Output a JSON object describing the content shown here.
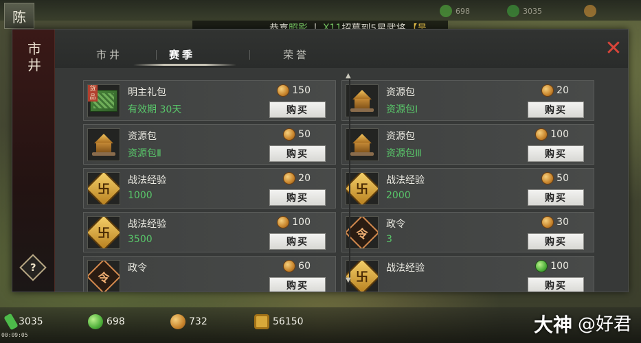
{
  "player": {
    "badge": "陈"
  },
  "top_bar_resources": [
    {
      "value": "698"
    },
    {
      "value": "3035"
    }
  ],
  "marquee": {
    "prefix": "恭喜",
    "name": "照影",
    "sep": "丨",
    "count": "X11",
    "text": "招募到5星武将",
    "tail": "【吴"
  },
  "panel": {
    "side_title": "市井",
    "help_label": "?",
    "close_label": "✕",
    "tabs": [
      {
        "label": "市井",
        "active": false
      },
      {
        "label": "赛季",
        "active": true
      },
      {
        "label": "荣誉",
        "active": false
      }
    ]
  },
  "shop": {
    "buy_label": "购买",
    "items": [
      {
        "name": "明主礼包",
        "sub": "有效期 30天",
        "price": "150",
        "currency": "gold",
        "icon": "gift-pack-icon",
        "tag": "货品"
      },
      {
        "name": "资源包",
        "sub": "资源包Ⅰ",
        "price": "20",
        "currency": "gold",
        "icon": "resource-pack-icon"
      },
      {
        "name": "资源包",
        "sub": "资源包Ⅱ",
        "price": "50",
        "currency": "gold",
        "icon": "resource-pack-icon"
      },
      {
        "name": "资源包",
        "sub": "资源包Ⅲ",
        "price": "100",
        "currency": "gold",
        "icon": "resource-pack-icon"
      },
      {
        "name": "战法经验",
        "sub": "1000",
        "price": "20",
        "currency": "gold",
        "icon": "skill-exp-icon",
        "glyph": "卐"
      },
      {
        "name": "战法经验",
        "sub": "2000",
        "price": "50",
        "currency": "gold",
        "icon": "skill-exp-icon",
        "glyph": "卐"
      },
      {
        "name": "战法经验",
        "sub": "3500",
        "price": "100",
        "currency": "gold",
        "icon": "skill-exp-icon",
        "glyph": "卐"
      },
      {
        "name": "政令",
        "sub": "3",
        "price": "30",
        "currency": "gold",
        "icon": "decree-icon",
        "glyph": "令"
      },
      {
        "name": "政令",
        "sub": "",
        "price": "60",
        "currency": "gold",
        "icon": "decree-icon",
        "glyph": "令"
      },
      {
        "name": "战法经验",
        "sub": "",
        "price": "100",
        "currency": "jade",
        "icon": "skill-exp-icon",
        "glyph": "卐"
      }
    ]
  },
  "bottom_resources": [
    {
      "value": "3035",
      "icon": "bamboo-icon",
      "color": "#4dbb4a"
    },
    {
      "value": "698",
      "icon": "jade-icon",
      "color": "#5fc24c"
    },
    {
      "value": "732",
      "icon": "gold-coin-icon",
      "color": "#e0a448"
    },
    {
      "value": "56150",
      "icon": "copper-coin-icon",
      "color": "#d8a83a"
    }
  ],
  "timer": "00:09:05",
  "watermark": {
    "a": "大神",
    "b": "@好君"
  },
  "colors": {
    "accent_green": "#59c76a",
    "close_red": "#d9453a"
  }
}
